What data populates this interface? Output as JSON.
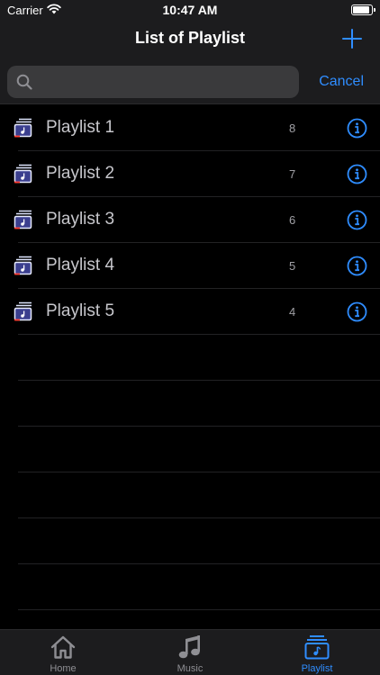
{
  "status": {
    "carrier": "Carrier",
    "time": "10:47 AM"
  },
  "nav": {
    "title": "List of Playlist"
  },
  "search": {
    "placeholder": "",
    "value": "",
    "cancel_label": "Cancel"
  },
  "playlists": [
    {
      "name": "Playlist 1",
      "count": "8"
    },
    {
      "name": "Playlist 2",
      "count": "7"
    },
    {
      "name": "Playlist 3",
      "count": "6"
    },
    {
      "name": "Playlist 4",
      "count": "5"
    },
    {
      "name": "Playlist 5",
      "count": "4"
    }
  ],
  "tabs": [
    {
      "label": "Home",
      "icon": "home-icon",
      "active": false
    },
    {
      "label": "Music",
      "icon": "music-note-icon",
      "active": false
    },
    {
      "label": "Playlist",
      "icon": "playlist-icon",
      "active": true
    }
  ],
  "colors": {
    "accent": "#2f8dff",
    "background": "#000000",
    "bar": "#1c1c1e",
    "search_field": "#3a3a3c"
  }
}
